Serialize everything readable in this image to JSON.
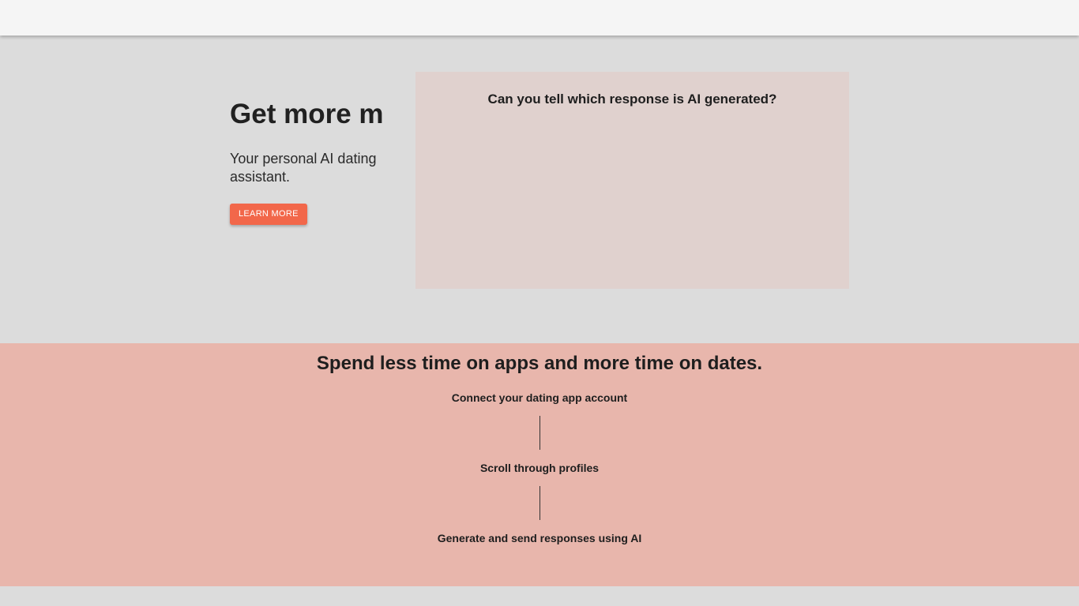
{
  "hero": {
    "title": "Get more m",
    "subtitle": "Your personal AI dating assistant.",
    "cta_label": "LEARN MORE"
  },
  "demo": {
    "title": "Can you tell which response is AI generated?"
  },
  "how_it_works": {
    "heading": "Spend less time on apps and more time on dates.",
    "steps": [
      {
        "label": "Connect your dating app account"
      },
      {
        "label": "Scroll through profiles"
      },
      {
        "label": "Generate and send responses using AI"
      }
    ]
  },
  "colors": {
    "accent": "#f2674a",
    "page_background": "#dcdcdc",
    "demo_card_background": "#e0d1ce",
    "steps_background": "#e8b6ac"
  }
}
